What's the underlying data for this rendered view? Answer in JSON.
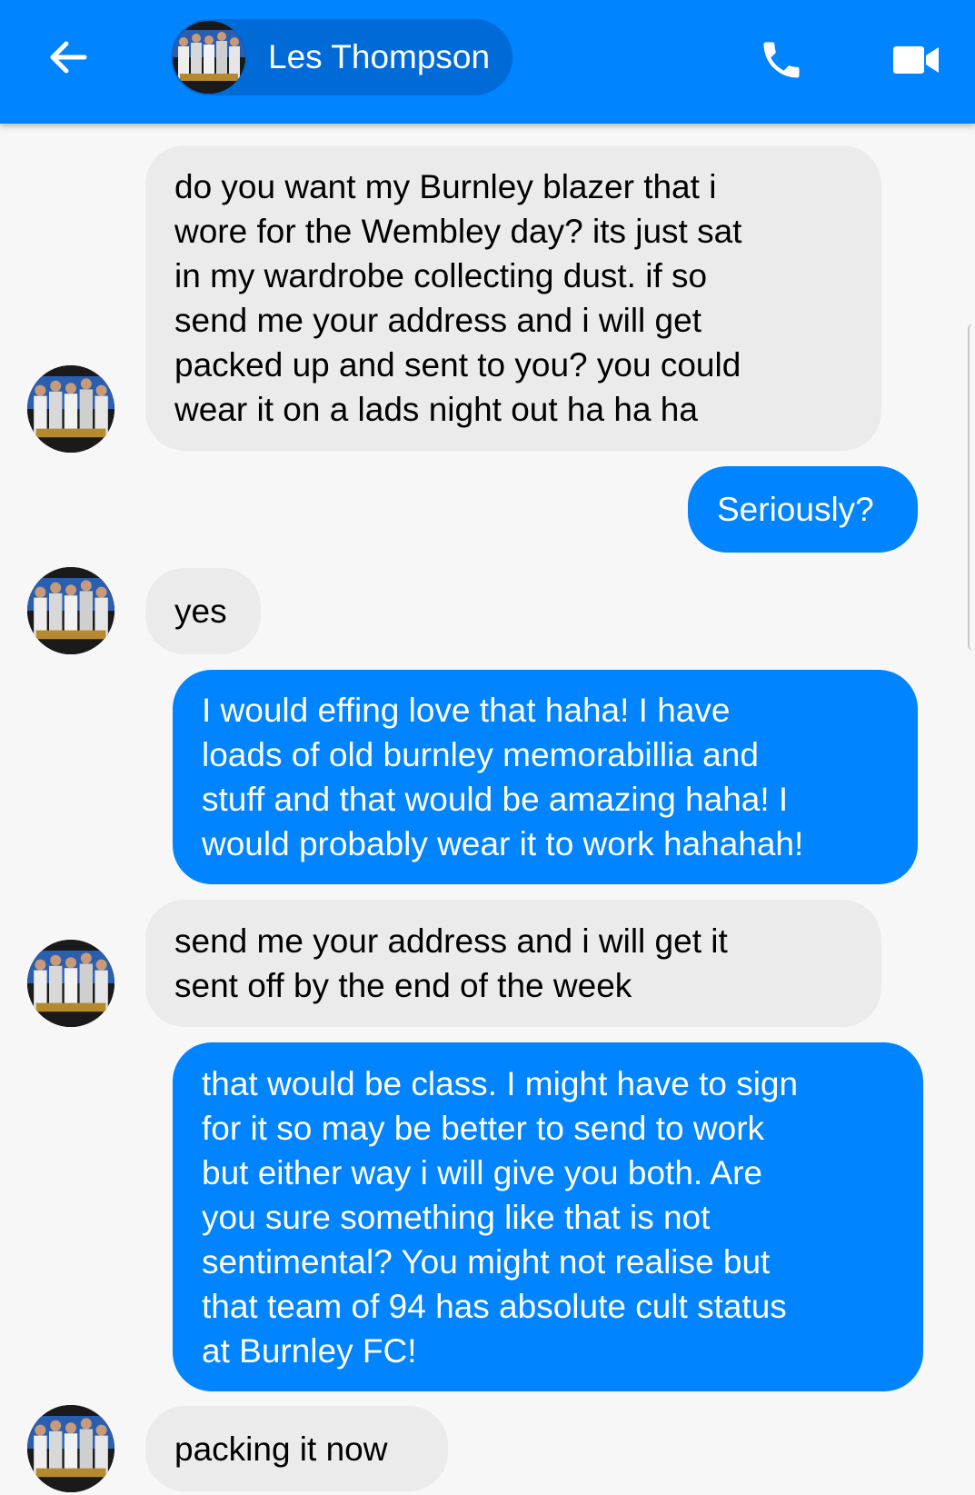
{
  "header": {
    "contact_name": "Les Thompson",
    "back_icon": "arrow-left-icon",
    "call_icon": "phone-icon",
    "video_icon": "video-camera-icon",
    "background_color": "#0084ff"
  },
  "messages": [
    {
      "sender": "contact",
      "text": "do you want my Burnley blazer that i\nwore for the Wembley day? its just sat\nin my wardrobe collecting dust. if so\nsend me your address and i will get\npacked up and sent to you? you could\nwear it on a lads night out ha ha ha"
    },
    {
      "sender": "me",
      "text": "Seriously?"
    },
    {
      "sender": "contact",
      "text": "yes"
    },
    {
      "sender": "me",
      "text": "I would effing love that haha! I have\nloads of old burnley memorabillia and\nstuff and that would be amazing haha! I\nwould probably wear it to work hahahah!"
    },
    {
      "sender": "contact",
      "text": "send me your address and i will get it\nsent off by the end of the week"
    },
    {
      "sender": "me",
      "text": "that would be class. I might have to sign\nfor it so may be better to send to work\nbut either way i will give you both. Are\nyou sure something like that is not\nsentimental? You might not realise but\nthat team of 94 has absolute cult status\nat Burnley FC!"
    },
    {
      "sender": "contact",
      "text": "packing it now"
    }
  ],
  "colors": {
    "outgoing_bubble": "#0084ff",
    "incoming_bubble": "#ebebeb",
    "background": "#f7f7f7"
  }
}
